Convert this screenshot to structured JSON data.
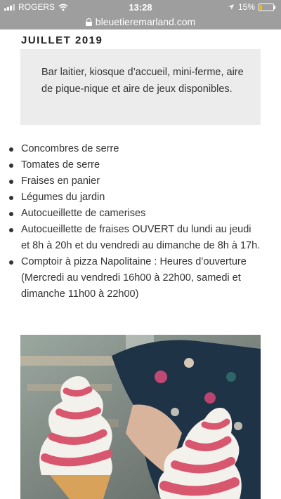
{
  "status_bar": {
    "carrier": "ROGERS",
    "time": "13:28",
    "battery_percent": "15%",
    "battery_level": 0.15,
    "battery_color": "#f2c200"
  },
  "url_bar": {
    "domain": "bleuetieremarland.com",
    "icon": "lock-icon"
  },
  "content": {
    "heading": "JUILLET 2019",
    "info_box": "Bar laitier, kiosque d’accueil, mini-ferme, aire de pique-nique et aire de jeux disponibles.",
    "items": [
      "Concombres de serre",
      "Tomates de serre",
      "Fraises en panier",
      "Légumes du jardin",
      "Autocueillette de camerises",
      "Autocueillette de fraises OUVERT du lundi au jeudi et 8h à 20h et du vendredi au dimanche de 8h à 17h.",
      "Comptoir à pizza Napolitaine : Heures d’ouverture (Mercredi au vendredi 16h00 à 22h00, samedi et dimanche 11h00 à 22h00)"
    ]
  },
  "colors": {
    "status_bar_bg": "#9e9e9e",
    "info_box_bg": "#ececec",
    "ice_cream_pink": "#d9576e"
  }
}
